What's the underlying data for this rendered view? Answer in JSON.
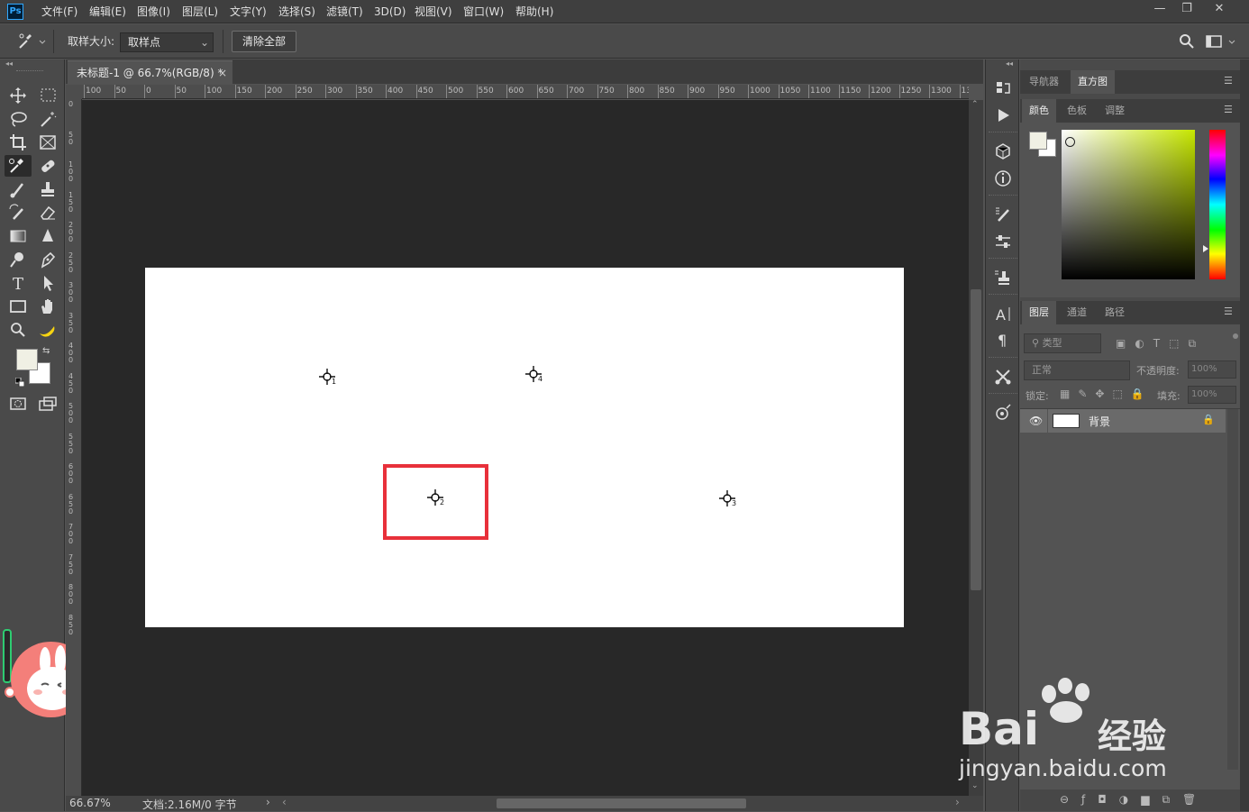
{
  "app": {
    "logo": "Ps"
  },
  "menu": [
    "文件(F)",
    "编辑(E)",
    "图像(I)",
    "图层(L)",
    "文字(Y)",
    "选择(S)",
    "滤镜(T)",
    "3D(D)",
    "视图(V)",
    "窗口(W)",
    "帮助(H)"
  ],
  "window_controls": {
    "minimize": "—",
    "restore": "❐",
    "close": "✕"
  },
  "options": {
    "sample_size_label": "取样大小:",
    "sample_size_value": "取样点",
    "clear_all_label": "清除全部"
  },
  "document": {
    "tab_title": "未标题-1 @ 66.7%(RGB/8) *",
    "tab_close": "×",
    "zoom": "66.67%",
    "doc_info": "文档:2.16M/0 字节"
  },
  "ruler_top": [
    "100",
    "50",
    "0",
    "50",
    "100",
    "150",
    "200",
    "250",
    "300",
    "350",
    "400",
    "450",
    "500",
    "550",
    "600",
    "650",
    "700",
    "750",
    "800",
    "850",
    "900",
    "950",
    "1000",
    "1050",
    "1100",
    "1150",
    "1200",
    "1250",
    "1300",
    "13"
  ],
  "ruler_left": [
    "0",
    "50",
    "100",
    "150",
    "200",
    "250",
    "300",
    "350",
    "400",
    "450",
    "500",
    "550",
    "600",
    "650",
    "700",
    "750",
    "800",
    "850"
  ],
  "samplers": [
    {
      "label": "1"
    },
    {
      "label": "4"
    },
    {
      "label": "2"
    },
    {
      "label": "3"
    }
  ],
  "highlight_color": "#e8303a",
  "panels": {
    "top_tabs": [
      "导航器",
      "直方图"
    ],
    "color_tabs": [
      "颜色",
      "色板",
      "调整"
    ],
    "layers_tabs": [
      "图层",
      "通道",
      "路径"
    ],
    "filter_kind": "类型",
    "blend_mode": "正常",
    "opacity_label": "不透明度:",
    "opacity_value": "100%",
    "lock_label": "锁定:",
    "fill_label": "填充:",
    "fill_value": "100%",
    "layer_name": "背景"
  },
  "watermark": {
    "brand": "Bai",
    "brand2": "经验",
    "url": "jingyan.baidu.com"
  }
}
